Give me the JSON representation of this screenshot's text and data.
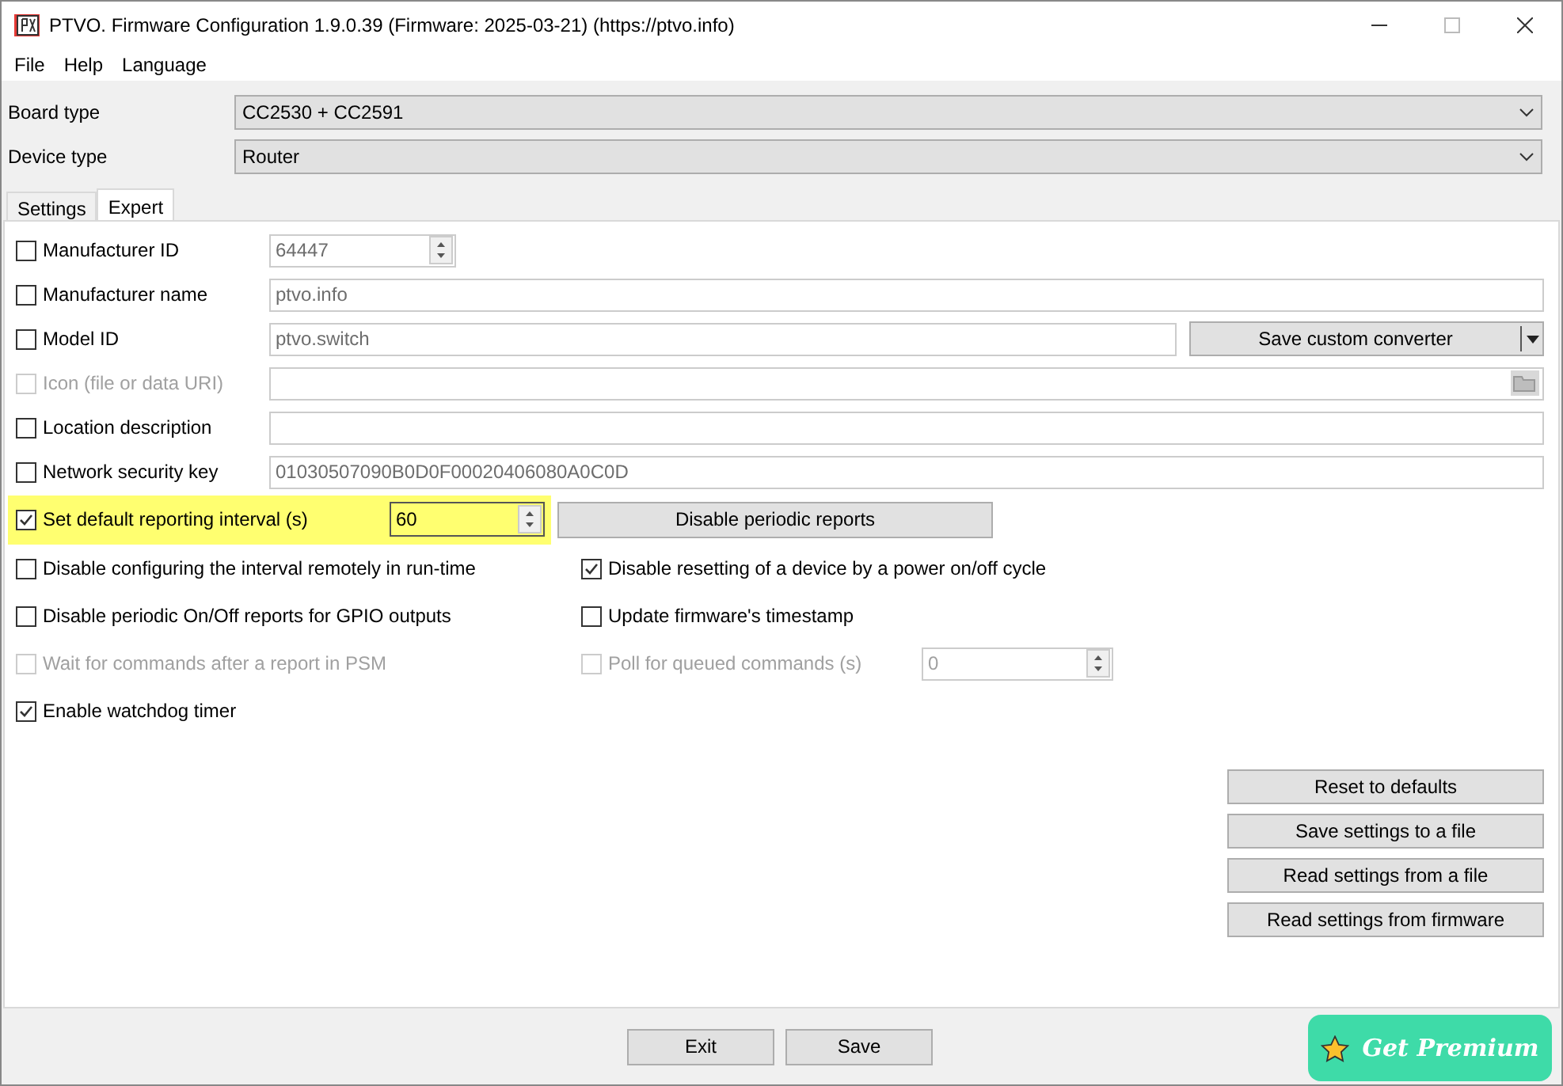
{
  "window": {
    "title": "PTVO. Firmware Configuration 1.9.0.39 (Firmware: 2025-03-21) (https://ptvo.info)"
  },
  "menu": [
    "File",
    "Help",
    "Language"
  ],
  "selectors": [
    {
      "label": "Board type",
      "value": "CC2530 + CC2591"
    },
    {
      "label": "Device type",
      "value": "Router"
    }
  ],
  "tabs": [
    {
      "label": "Settings",
      "selected": false
    },
    {
      "label": "Expert",
      "selected": true
    }
  ],
  "fields": [
    {
      "kind": "spin",
      "label": "Manufacturer ID",
      "checked": false,
      "disabled": false,
      "value": "64447"
    },
    {
      "kind": "text",
      "label": "Manufacturer name",
      "checked": false,
      "disabled": false,
      "value": "ptvo.info"
    },
    {
      "kind": "split",
      "label": "Model ID",
      "checked": false,
      "disabled": false,
      "value": "ptvo.switch",
      "button": "Save custom converter"
    },
    {
      "kind": "file",
      "label": "Icon (file or data URI)",
      "checked": false,
      "disabled": true
    },
    {
      "kind": "text",
      "label": "Location description",
      "checked": false,
      "disabled": false
    },
    {
      "kind": "text",
      "label": "Network security key",
      "checked": false,
      "disabled": false,
      "value": "01030507090B0D0F00020406080A0C0D"
    }
  ],
  "reporting": {
    "label": "Set default reporting interval (s)",
    "checked": true,
    "highlighted": true,
    "value": "60",
    "button": "Disable periodic reports"
  },
  "option_rows": [
    {
      "left": {
        "label": "Disable configuring the interval remotely in run-time",
        "checked": false,
        "disabled": false
      },
      "right": {
        "label": "Disable resetting of a device by a power on/off cycle",
        "checked": true,
        "disabled": false
      }
    },
    {
      "left": {
        "label": "Disable periodic On/Off reports for GPIO outputs",
        "checked": false,
        "disabled": false
      },
      "right": {
        "label": "Update firmware's timestamp",
        "checked": false,
        "disabled": false
      }
    },
    {
      "left": {
        "label": "Wait for commands after a report in PSM",
        "checked": false,
        "disabled": true
      },
      "right": {
        "label": "Poll for queued commands (s)",
        "checked": false,
        "disabled": true,
        "value": "0"
      }
    },
    {
      "left": {
        "label": "Enable watchdog timer",
        "checked": true,
        "disabled": false
      }
    }
  ],
  "actions": [
    "Reset to defaults",
    "Save settings to a file",
    "Read settings from a file",
    "Read settings from firmware"
  ],
  "footer_buttons": [
    "Exit",
    "Save"
  ],
  "premium": {
    "label": "Get Premium"
  }
}
